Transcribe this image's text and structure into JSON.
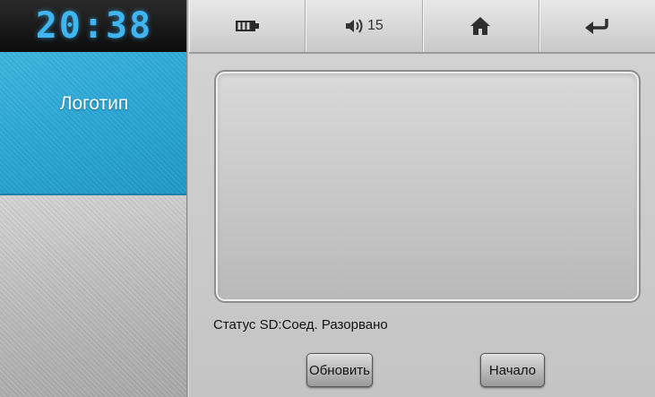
{
  "clock": {
    "time": "20:38"
  },
  "sidebar": {
    "items": [
      {
        "label": "Логотип",
        "active": true
      }
    ]
  },
  "topbar": {
    "battery": {
      "icon": "battery-icon"
    },
    "volume": {
      "icon": "speaker-icon",
      "level": "15"
    },
    "home": {
      "icon": "home-icon"
    },
    "back": {
      "icon": "back-arrow-icon"
    }
  },
  "main": {
    "status_text": "Статус SD:Соед. Разорвано",
    "buttons": {
      "update_label": "Обновить",
      "start_label": "Начало"
    }
  },
  "colors": {
    "accent": "#2aa7d6",
    "clock": "#3fb6f2"
  }
}
